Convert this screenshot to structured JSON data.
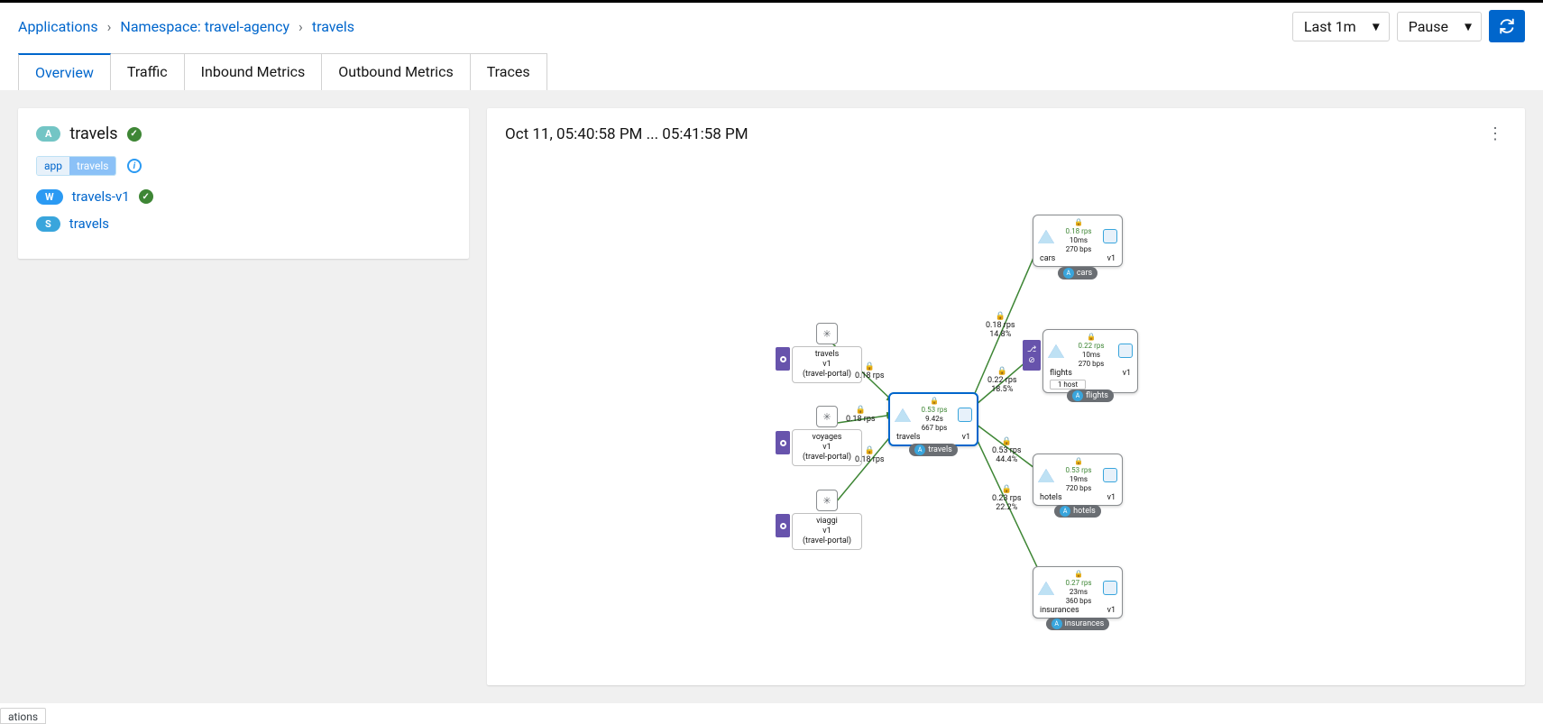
{
  "breadcrumb": {
    "applications": "Applications",
    "namespace": "Namespace: travel-agency",
    "current": "travels"
  },
  "controls": {
    "time_range": "Last 1m",
    "pause": "Pause"
  },
  "tabs": {
    "overview": "Overview",
    "traffic": "Traffic",
    "inbound": "Inbound Metrics",
    "outbound": "Outbound Metrics",
    "traces": "Traces"
  },
  "left": {
    "badgeA": "A",
    "title": "travels",
    "label_key": "app",
    "label_val": "travels",
    "badgeW": "W",
    "workload": "travels-v1",
    "badgeS": "S",
    "service": "travels"
  },
  "timestamp": "Oct 11, 05:40:58 PM ... 05:41:58 PM",
  "graph": {
    "sources": [
      {
        "name": "travels",
        "ver": "v1",
        "ns": "(travel-portal)"
      },
      {
        "name": "voyages",
        "ver": "v1",
        "ns": "(travel-portal)"
      },
      {
        "name": "viaggi",
        "ver": "v1",
        "ns": "(travel-portal)"
      }
    ],
    "center": {
      "name": "travels",
      "v": "v1",
      "rps": "0.53 rps",
      "lat": "9.42s",
      "bps": "667 bps",
      "badge": "travels"
    },
    "targets": {
      "cars": {
        "name": "cars",
        "v": "v1",
        "rps": "0.18 rps",
        "lat": "10ms",
        "bps": "270 bps",
        "badge": "cars"
      },
      "flights": {
        "name": "flights",
        "v": "v1",
        "rps": "0.22 rps",
        "lat": "10ms",
        "bps": "270 bps",
        "host": "1 host",
        "badge": "flights"
      },
      "hotels": {
        "name": "hotels",
        "v": "v1",
        "rps": "0.53 rps",
        "lat": "19ms",
        "bps": "720 bps",
        "badge": "hotels"
      },
      "insurances": {
        "name": "insurances",
        "v": "v1",
        "rps": "0.27 rps",
        "lat": "23ms",
        "bps": "360 bps",
        "badge": "insurances"
      }
    },
    "edges": {
      "src_travels": "0.18 rps",
      "src_voyages": "0.18 rps",
      "src_viaggi": "0.18 rps",
      "to_cars": {
        "rps": "0.18 rps",
        "pct": "14.8%"
      },
      "to_flights": {
        "rps": "0.22 rps",
        "pct": "18.5%"
      },
      "to_hotels": {
        "rps": "0.53 rps",
        "pct": "44.4%"
      },
      "to_insurances": {
        "rps": "0.23 rps",
        "pct": "22.2%"
      }
    }
  },
  "bottom_stub": "ations",
  "badgeLetter": "A"
}
